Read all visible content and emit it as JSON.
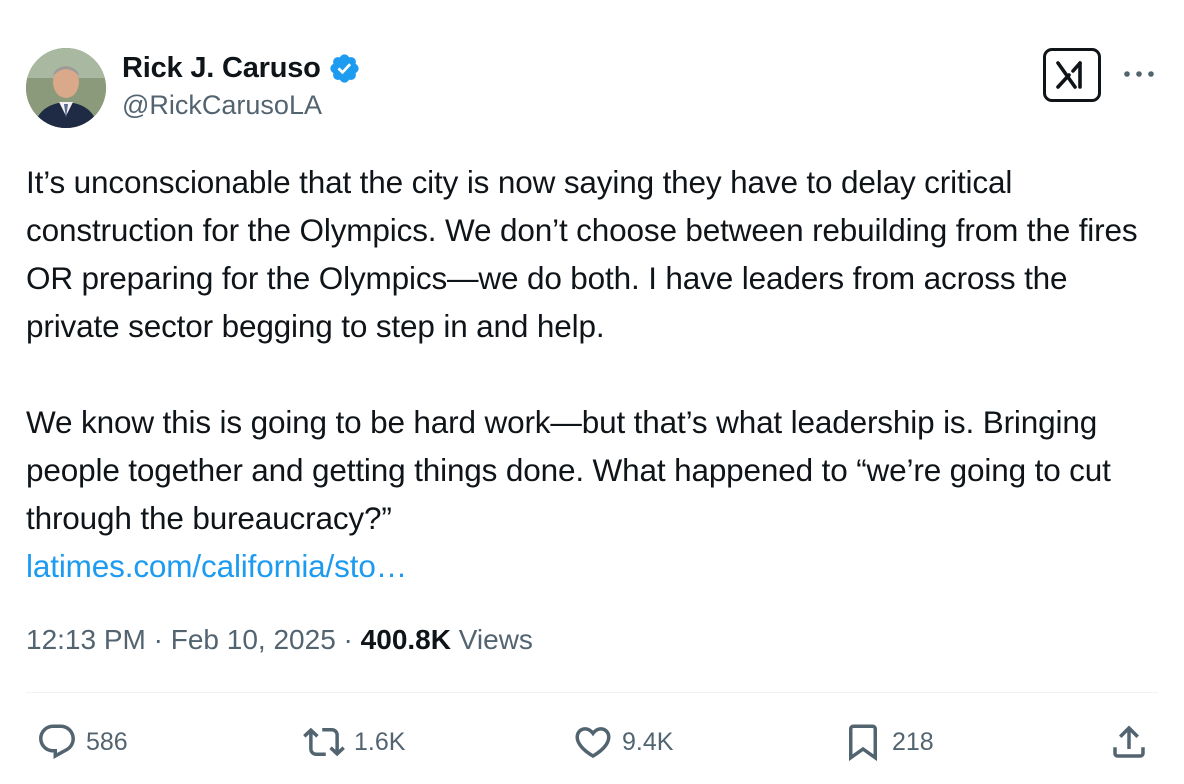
{
  "author": {
    "display_name": "Rick J. Caruso",
    "handle": "@RickCarusoLA",
    "verified": true,
    "avatar_icon": "profile-photo"
  },
  "header_actions": {
    "grok_icon": "grok-icon",
    "more_icon": "more-icon"
  },
  "tweet": {
    "paragraph_1": "It’s unconscionable that the city is now saying they have to delay critical construction for the Olympics. We don’t choose between rebuilding from the fires OR preparing for the Olympics—we do both. I have leaders from across the private sector begging to step in and help.",
    "paragraph_2": "We know this is going to be hard work—but that’s what leadership is. Bringing people together and getting things done.  What happened to “we’re going to cut through the bureaucracy?”",
    "link_text": "latimes.com/california/sto…"
  },
  "meta": {
    "time": "12:13 PM",
    "separator": " · ",
    "date": "Feb 10, 2025",
    "views_count": "400.8K",
    "views_label": " Views"
  },
  "actions": {
    "reply": {
      "icon": "reply-icon",
      "count": "586"
    },
    "repost": {
      "icon": "repost-icon",
      "count": "1.6K"
    },
    "like": {
      "icon": "heart-icon",
      "count": "9.4K"
    },
    "bookmark": {
      "icon": "bookmark-icon",
      "count": "218"
    },
    "share": {
      "icon": "share-icon"
    }
  },
  "colors": {
    "text": "#0f1419",
    "secondary": "#536471",
    "link": "#1d9bf0",
    "verified": "#1d9bf0",
    "divider": "#eff3f4"
  }
}
